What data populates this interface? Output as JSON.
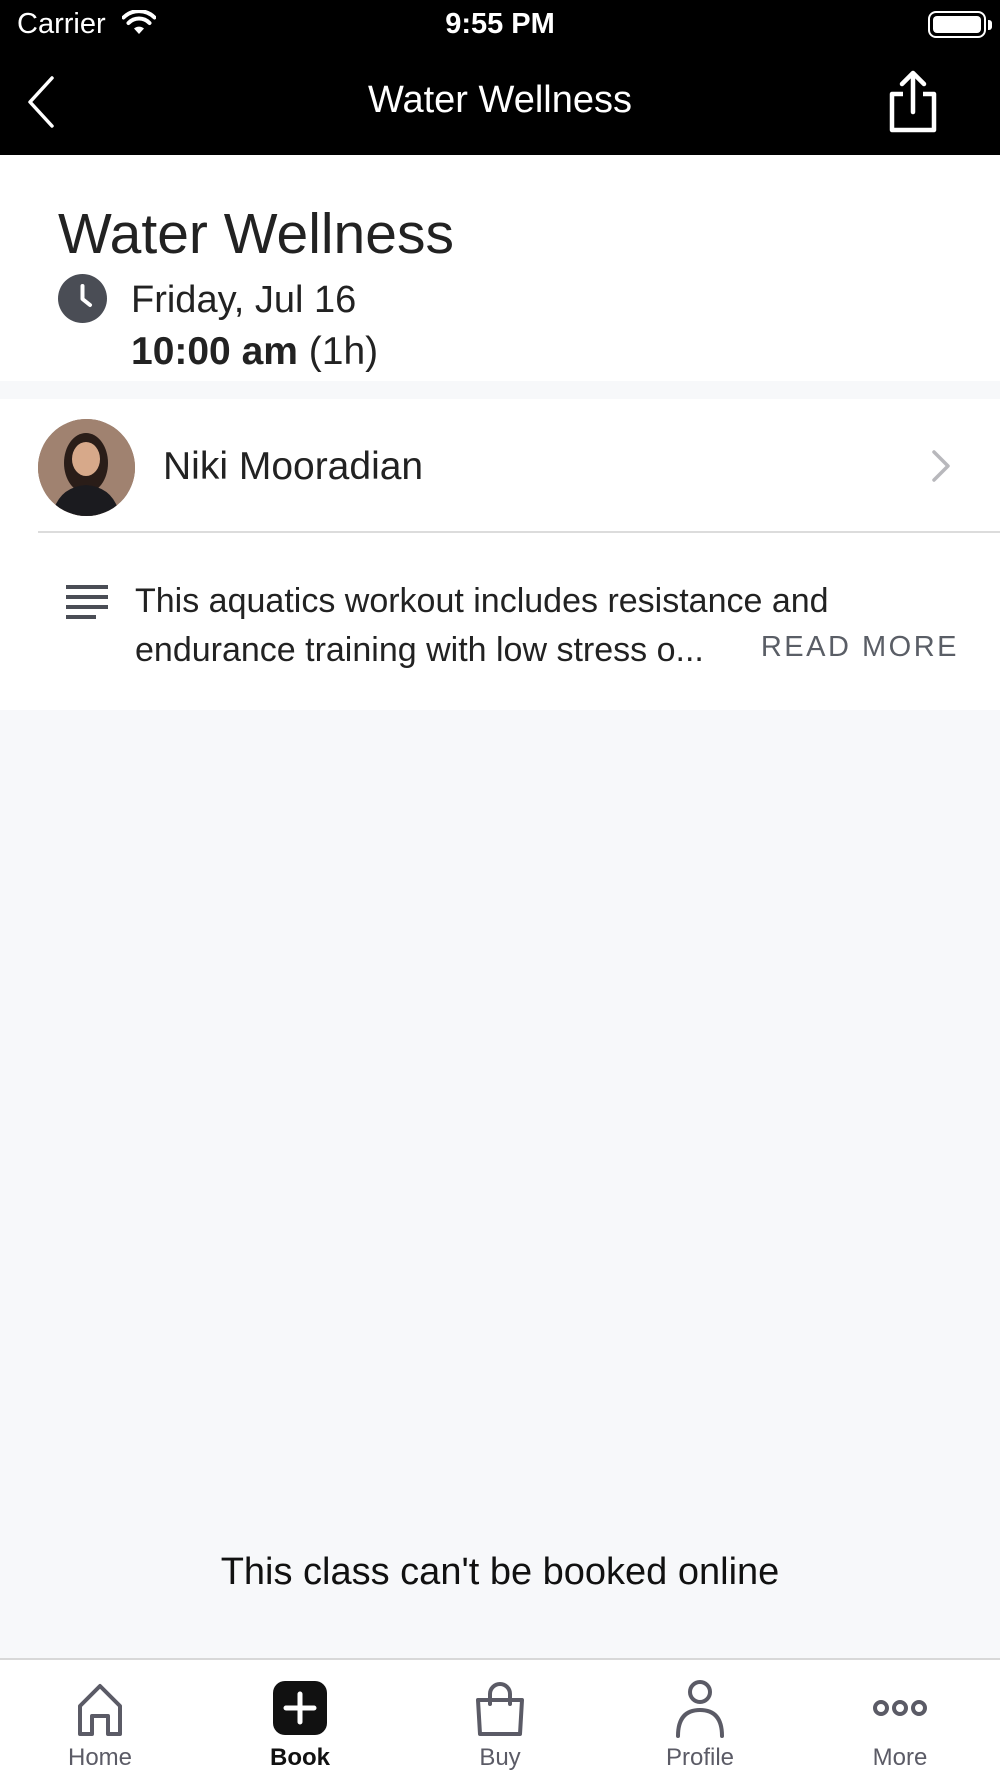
{
  "status_bar": {
    "carrier": "Carrier",
    "time": "9:55 PM"
  },
  "nav": {
    "title": "Water Wellness"
  },
  "class": {
    "title": "Water Wellness",
    "date": "Friday, Jul 16",
    "time": "10:00 am",
    "duration": "(1h)"
  },
  "instructor": {
    "name": "Niki Mooradian"
  },
  "description": {
    "text": "This aquatics workout includes resistance and endurance training with low stress o...",
    "read_more": "READ MORE"
  },
  "booking": {
    "message": "This class can't be booked online"
  },
  "tabs": [
    {
      "label": "Home",
      "icon": "home-icon"
    },
    {
      "label": "Book",
      "icon": "plus-square-icon"
    },
    {
      "label": "Buy",
      "icon": "shopping-bag-icon"
    },
    {
      "label": "Profile",
      "icon": "person-icon"
    },
    {
      "label": "More",
      "icon": "more-dots-icon"
    }
  ],
  "colors": {
    "nav_bg": "#000000",
    "page_bg": "#f7f8fa",
    "accent": "#222222"
  }
}
